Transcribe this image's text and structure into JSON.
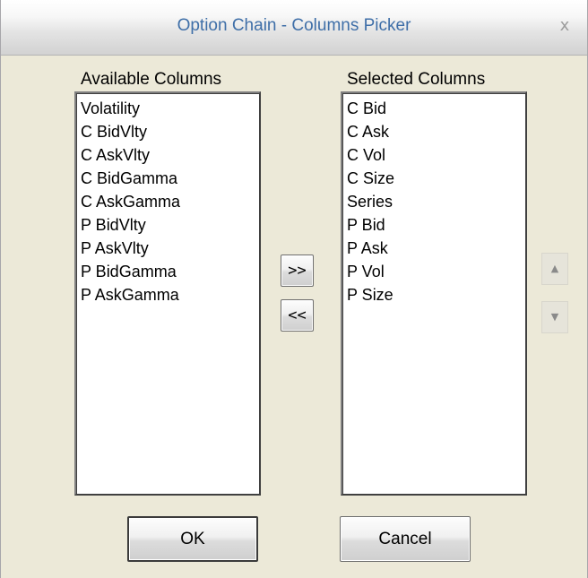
{
  "window": {
    "title": "Option Chain - Columns Picker",
    "close_glyph": "x"
  },
  "available": {
    "label": "Available Columns",
    "items": [
      "Volatility",
      "C BidVlty",
      "C AskVlty",
      "C BidGamma",
      "C AskGamma",
      "P BidVlty",
      "P AskVlty",
      "P BidGamma",
      "P AskGamma"
    ]
  },
  "selected": {
    "label": "Selected Columns",
    "items": [
      "C Bid",
      "C Ask",
      "C Vol",
      "C Size",
      "Series",
      "P Bid",
      "P Ask",
      "P Vol",
      "P Size"
    ]
  },
  "transfer": {
    "add_label": ">>",
    "remove_label": "<<"
  },
  "order": {
    "up_glyph": "▲",
    "down_glyph": "▼"
  },
  "footer": {
    "ok_label": "OK",
    "cancel_label": "Cancel"
  }
}
